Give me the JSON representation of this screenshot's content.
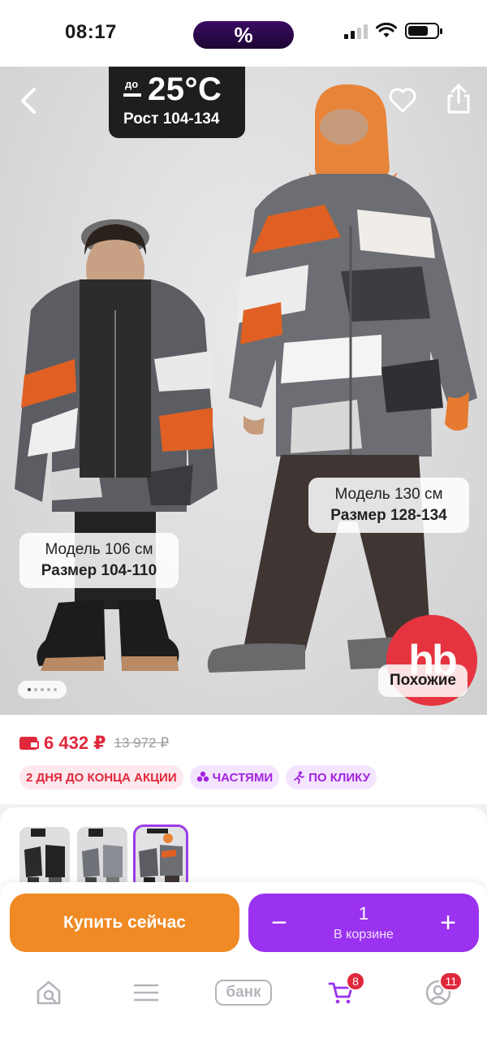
{
  "status_bar": {
    "time": "08:17",
    "promo_pill": "%"
  },
  "hero": {
    "temperature_prefix": "до",
    "temperature": "25°C",
    "height_range": "Рост 104-134",
    "model_left": {
      "height": "Модель 106 см",
      "size": "Размер 104-110"
    },
    "model_right": {
      "height": "Модель 130 см",
      "size": "Размер 128-134"
    },
    "brand_logo": "hb",
    "similar_label": "Похожие",
    "gallery": {
      "current": 1,
      "total": 5
    }
  },
  "price": {
    "current": "6 432 ₽",
    "old": "13 972 ₽",
    "accent_color": "#e0283c"
  },
  "badges": [
    {
      "icon": "none",
      "label": "2 ДНЯ ДО КОНЦА АКЦИИ"
    },
    {
      "icon": "split-payment-icon",
      "label": "ЧАСТЯМИ"
    },
    {
      "icon": "running-person-icon",
      "label": "ПО КЛИКУ"
    }
  ],
  "thumbnails": {
    "count": 3,
    "selected": 3
  },
  "actions": {
    "buy_now": "Купить сейчас",
    "quantity": "1",
    "in_cart": "В корзине",
    "minus": "−",
    "plus": "+",
    "buy_color": "#f08a24",
    "cart_color": "#9b32f0"
  },
  "bottom_nav": {
    "items": [
      {
        "name": "home-search",
        "icon": "home-search-icon"
      },
      {
        "name": "catalog",
        "icon": "menu-icon"
      },
      {
        "name": "bank",
        "label": "банк"
      },
      {
        "name": "cart",
        "icon": "cart-icon",
        "badge": "8"
      },
      {
        "name": "profile",
        "icon": "profile-icon",
        "badge": "11"
      }
    ]
  }
}
